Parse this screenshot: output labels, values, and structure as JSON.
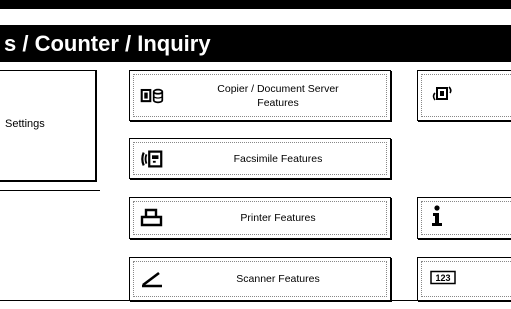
{
  "title": "s / Counter / Inquiry",
  "left_panel": {
    "label": "Settings"
  },
  "buttons": [
    {
      "label_line1": "Copier / Document Server",
      "label_line2": "Features",
      "icon": "copier-icon"
    },
    {
      "label": "Facsimile Features",
      "icon": "facsimile-icon"
    },
    {
      "label": "Printer Features",
      "icon": "printer-icon"
    },
    {
      "label": "Scanner Features",
      "icon": "scanner-icon"
    }
  ],
  "right_buttons": [
    {
      "icon": "counter-icon"
    },
    {
      "icon": "info-icon"
    },
    {
      "icon": "123-icon",
      "text": "123"
    }
  ]
}
